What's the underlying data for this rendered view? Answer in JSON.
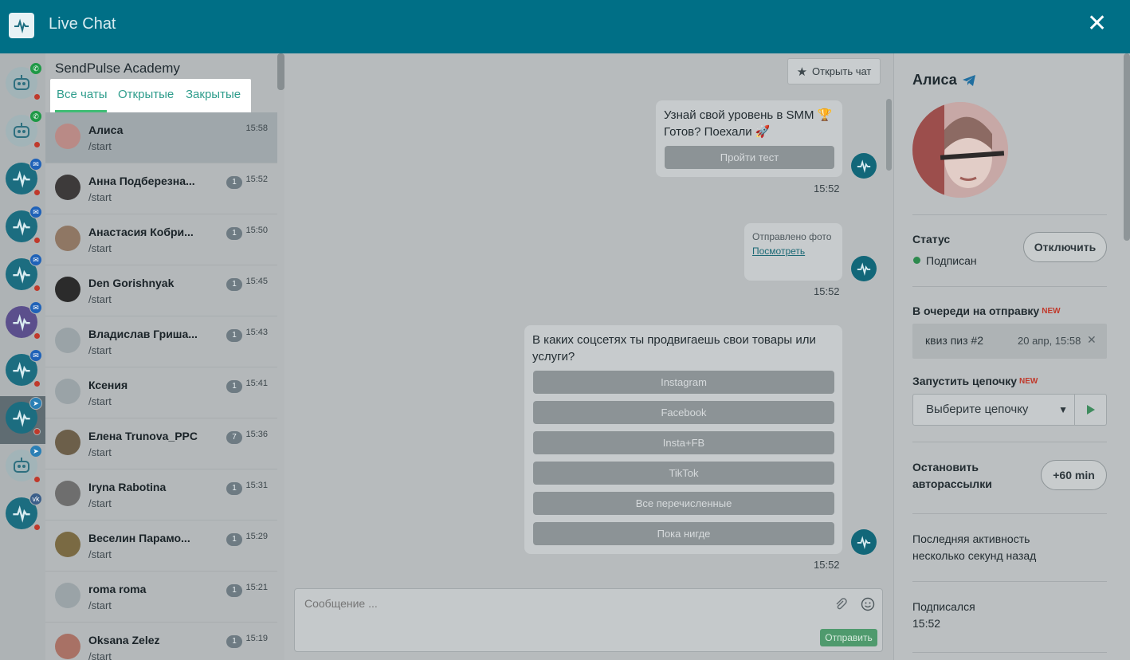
{
  "app": {
    "title": "Live Chat"
  },
  "bots": [
    {
      "kind": "robot",
      "channel": "whatsapp",
      "channel_icon": "whatsapp-icon"
    },
    {
      "kind": "robot",
      "channel": "whatsapp",
      "channel_icon": "whatsapp-icon"
    },
    {
      "kind": "pulse",
      "channel": "messenger",
      "channel_icon": "messenger-icon"
    },
    {
      "kind": "pulse",
      "channel": "messenger",
      "channel_icon": "messenger-icon"
    },
    {
      "kind": "pulse",
      "channel": "messenger",
      "channel_icon": "messenger-icon"
    },
    {
      "kind": "purple",
      "channel": "messenger",
      "channel_icon": "messenger-icon"
    },
    {
      "kind": "pulse",
      "channel": "messenger",
      "channel_icon": "messenger-icon"
    },
    {
      "kind": "pulse",
      "channel": "telegram",
      "channel_icon": "telegram-icon",
      "selected": true
    },
    {
      "kind": "robot",
      "channel": "telegram",
      "channel_icon": "telegram-icon"
    },
    {
      "kind": "pulse",
      "channel": "vk",
      "channel_icon": "vk-icon"
    }
  ],
  "chat_list": {
    "org_name": "SendPulse Academy",
    "tabs": [
      {
        "label": "Все чаты",
        "active": true
      },
      {
        "label": "Открытые",
        "active": false
      },
      {
        "label": "Закрытые",
        "active": false
      }
    ],
    "chats": [
      {
        "name": "Алиса",
        "cmd": "/start",
        "time": "15:58",
        "count": "",
        "active": true
      },
      {
        "name": "Анна Подберезна...",
        "cmd": "/start",
        "time": "15:52",
        "count": "1"
      },
      {
        "name": "Анастасия Кобри...",
        "cmd": "/start",
        "time": "15:50",
        "count": "1"
      },
      {
        "name": "Den Gorishnyak",
        "cmd": "/start",
        "time": "15:45",
        "count": "1"
      },
      {
        "name": "Владислав Гриша...",
        "cmd": "/start",
        "time": "15:43",
        "count": "1"
      },
      {
        "name": "Ксения",
        "cmd": "/start",
        "time": "15:41",
        "count": "1"
      },
      {
        "name": "Елена Trunova_PPC",
        "cmd": "/start",
        "time": "15:36",
        "count": "7"
      },
      {
        "name": "Iryna Rabotina",
        "cmd": "/start",
        "time": "15:31",
        "count": "1"
      },
      {
        "name": "Веселин Парамо...",
        "cmd": "/start",
        "time": "15:29",
        "count": "1"
      },
      {
        "name": "roma roma",
        "cmd": "/start",
        "time": "15:21",
        "count": "1"
      },
      {
        "name": "Oksana Zelez",
        "cmd": "/start",
        "time": "15:19",
        "count": "1"
      }
    ]
  },
  "conversation": {
    "open_chat_label": "Открыть чат",
    "messages": [
      {
        "text1": "Узнай свой уровень в SMM 🏆",
        "text2": "Готов? Поехали 🚀",
        "button": "Пройти тест",
        "time": "15:52"
      },
      {
        "photo_label": "Отправлено фото",
        "photo_link": "Посмотреть",
        "time": "15:52"
      },
      {
        "text1": "В каких соцсетях ты продвигаешь свои товары или",
        "text2": "услуги?",
        "buttons": [
          "Instagram",
          "Facebook",
          "Insta+FB",
          "TikTok",
          "Все перечисленные",
          "Пока нигде"
        ],
        "time": "15:52"
      }
    ],
    "composer": {
      "placeholder": "Сообщение ...",
      "send_label": "Отправить"
    }
  },
  "profile": {
    "name": "Алиса",
    "status_label": "Статус",
    "status_value": "Подписан",
    "status_color": "#2d8a4e",
    "unsubscribe_label": "Отключить",
    "queue_label": "В очереди на отправку",
    "new_tag": "NEW",
    "queue_item": {
      "name": "квиз пиз #2",
      "date": "20 апр, 15:58"
    },
    "chain_label": "Запустить цепочку",
    "chain_placeholder": "Выберите цепочку",
    "stop_label_1": "Остановить",
    "stop_label_2": "авторассылки",
    "stop_btn": "+60 min",
    "activity_label_1": "Последняя активность",
    "activity_label_2": "несколько секунд назад",
    "subscribed_label": "Подписался",
    "subscribed_time": "15:52"
  },
  "colors": {
    "header": "#006f86",
    "accent": "#3fbd75",
    "tab_text": "#2f9d8c"
  }
}
